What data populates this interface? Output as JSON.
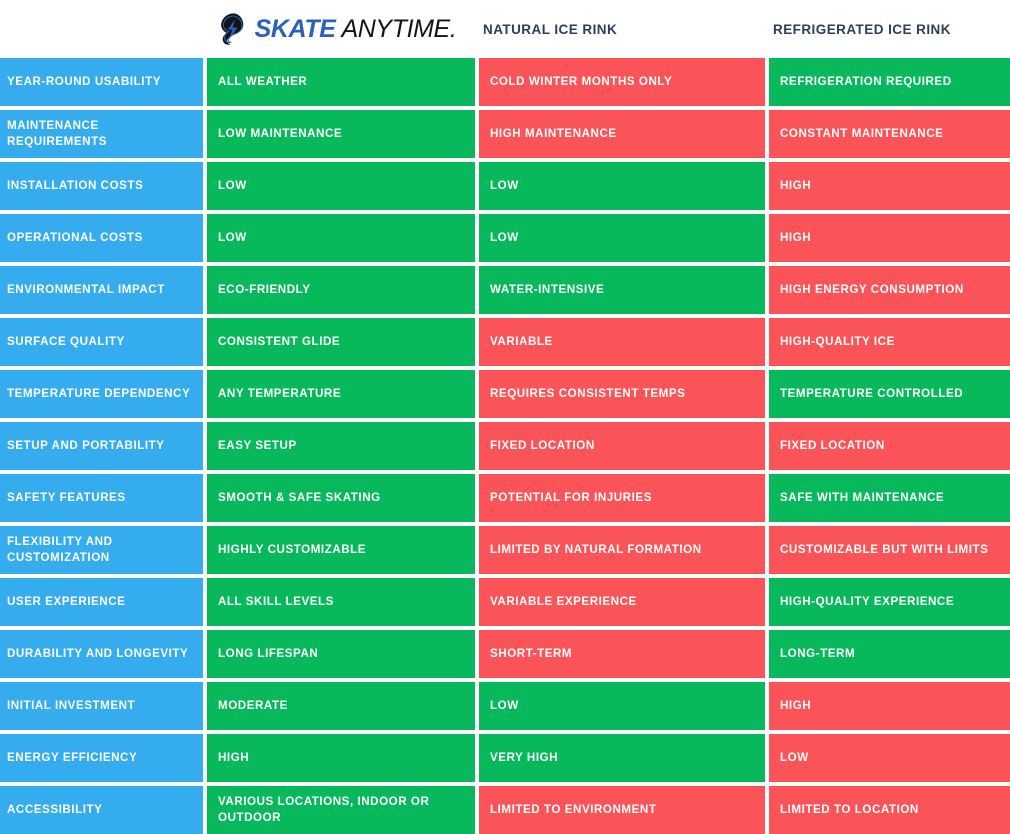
{
  "header": {
    "brand": {
      "logo_icon": "skate-anytime-logo-icon",
      "name_part1": "SKATE",
      "name_part2": "ANYTIME.",
      "color_primary": "#2a62b8",
      "color_secondary": "#111417"
    },
    "columns": [
      {
        "key": "label",
        "label": ""
      },
      {
        "key": "brand",
        "label": "SKATE ANYTIME"
      },
      {
        "key": "natural",
        "label": "NATURAL ICE RINK"
      },
      {
        "key": "refrig",
        "label": "REFRIGERATED ICE RINK"
      }
    ]
  },
  "colors": {
    "label_blue": "#35acee",
    "good_green": "#07b95a",
    "bad_red": "#fa5458",
    "header_text": "#2d3e5c",
    "cell_text": "#ffffff"
  },
  "rows": [
    {
      "label": "YEAR-ROUND USABILITY",
      "brand": {
        "text": "ALL WEATHER",
        "state": "good"
      },
      "natural": {
        "text": "COLD WINTER MONTHS ONLY",
        "state": "bad"
      },
      "refrig": {
        "text": "REFRIGERATION REQUIRED",
        "state": "good"
      }
    },
    {
      "label": "MAINTENANCE REQUIREMENTS",
      "brand": {
        "text": "LOW MAINTENANCE",
        "state": "good"
      },
      "natural": {
        "text": "HIGH MAINTENANCE",
        "state": "bad"
      },
      "refrig": {
        "text": "CONSTANT MAINTENANCE",
        "state": "bad"
      }
    },
    {
      "label": "INSTALLATION COSTS",
      "brand": {
        "text": "LOW",
        "state": "good"
      },
      "natural": {
        "text": "LOW",
        "state": "good"
      },
      "refrig": {
        "text": "HIGH",
        "state": "bad"
      }
    },
    {
      "label": "OPERATIONAL COSTS",
      "brand": {
        "text": "LOW",
        "state": "good"
      },
      "natural": {
        "text": "LOW",
        "state": "good"
      },
      "refrig": {
        "text": "HIGH",
        "state": "bad"
      }
    },
    {
      "label": "ENVIRONMENTAL IMPACT",
      "brand": {
        "text": "ECO-FRIENDLY",
        "state": "good"
      },
      "natural": {
        "text": "WATER-INTENSIVE",
        "state": "good"
      },
      "refrig": {
        "text": "HIGH ENERGY CONSUMPTION",
        "state": "bad"
      }
    },
    {
      "label": "SURFACE QUALITY",
      "brand": {
        "text": "CONSISTENT GLIDE",
        "state": "good"
      },
      "natural": {
        "text": "VARIABLE",
        "state": "bad"
      },
      "refrig": {
        "text": "HIGH-QUALITY ICE",
        "state": "bad"
      }
    },
    {
      "label": "TEMPERATURE DEPENDENCY",
      "brand": {
        "text": "ANY TEMPERATURE",
        "state": "good"
      },
      "natural": {
        "text": "REQUIRES CONSISTENT TEMPS",
        "state": "bad"
      },
      "refrig": {
        "text": "TEMPERATURE CONTROLLED",
        "state": "good"
      }
    },
    {
      "label": "SETUP AND PORTABILITY",
      "brand": {
        "text": "EASY SETUP",
        "state": "good"
      },
      "natural": {
        "text": "FIXED LOCATION",
        "state": "bad"
      },
      "refrig": {
        "text": "FIXED LOCATION",
        "state": "bad"
      }
    },
    {
      "label": "SAFETY FEATURES",
      "brand": {
        "text": "SMOOTH & SAFE SKATING",
        "state": "good"
      },
      "natural": {
        "text": "POTENTIAL FOR INJURIES",
        "state": "bad"
      },
      "refrig": {
        "text": "SAFE WITH MAINTENANCE",
        "state": "good"
      }
    },
    {
      "label": "FLEXIBILITY AND CUSTOMIZATION",
      "brand": {
        "text": "HIGHLY CUSTOMIZABLE",
        "state": "good"
      },
      "natural": {
        "text": "LIMITED BY NATURAL FORMATION",
        "state": "bad"
      },
      "refrig": {
        "text": "CUSTOMIZABLE BUT WITH LIMITS",
        "state": "bad"
      }
    },
    {
      "label": "USER EXPERIENCE",
      "brand": {
        "text": "ALL SKILL LEVELS",
        "state": "good"
      },
      "natural": {
        "text": "VARIABLE EXPERIENCE",
        "state": "bad"
      },
      "refrig": {
        "text": "HIGH-QUALITY EXPERIENCE",
        "state": "good"
      }
    },
    {
      "label": "DURABILITY AND LONGEVITY",
      "brand": {
        "text": "LONG LIFESPAN",
        "state": "good"
      },
      "natural": {
        "text": "SHORT-TERM",
        "state": "bad"
      },
      "refrig": {
        "text": "LONG-TERM",
        "state": "good"
      }
    },
    {
      "label": "INITIAL INVESTMENT",
      "brand": {
        "text": "MODERATE",
        "state": "good"
      },
      "natural": {
        "text": "LOW",
        "state": "good"
      },
      "refrig": {
        "text": "HIGH",
        "state": "bad"
      }
    },
    {
      "label": "ENERGY EFFICIENCY",
      "brand": {
        "text": "HIGH",
        "state": "good"
      },
      "natural": {
        "text": "VERY HIGH",
        "state": "good"
      },
      "refrig": {
        "text": "LOW",
        "state": "bad"
      }
    },
    {
      "label": "ACCESSIBILITY",
      "brand": {
        "text": "VARIOUS LOCATIONS, INDOOR OR OUTDOOR",
        "state": "good"
      },
      "natural": {
        "text": "LIMITED TO ENVIRONMENT",
        "state": "bad"
      },
      "refrig": {
        "text": " LIMITED TO LOCATION",
        "state": "bad"
      }
    }
  ]
}
